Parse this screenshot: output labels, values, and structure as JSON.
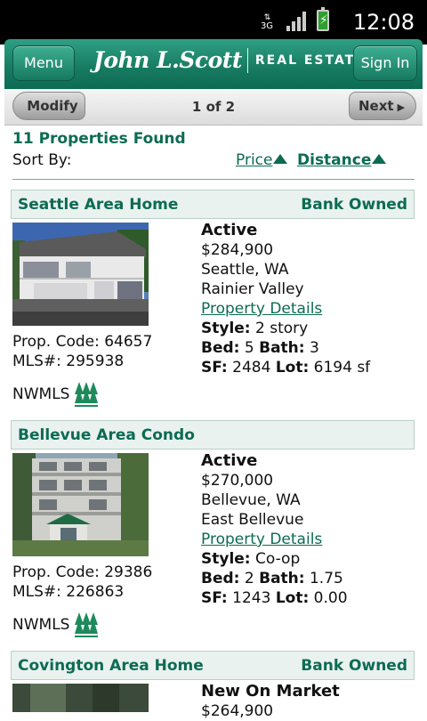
{
  "status_bar": {
    "network": "3G",
    "time": "12:08"
  },
  "header": {
    "menu_label": "Menu",
    "logo_name": "John L.Scott",
    "logo_suffix": "REAL ESTATE",
    "signin_label": "Sign In"
  },
  "pager": {
    "modify_label": "Modify",
    "page_indicator": "1 of 2",
    "next_label": "Next"
  },
  "results": {
    "found_text": "11 Properties Found",
    "sort_label": "Sort By:",
    "sort_price": "Price",
    "sort_distance": "Distance"
  },
  "listings": [
    {
      "title": "Seattle Area Home",
      "tag": "Bank Owned",
      "prop_code": "Prop. Code: 64657",
      "mls": "MLS#: 295938",
      "source": "NWMLS",
      "status": "Active",
      "price": "$284,900",
      "city": "Seattle, WA",
      "area": "Rainier Valley",
      "details_link": "Property Details",
      "style_label": "Style:",
      "style_value": "2 story",
      "bed_label": "Bed:",
      "bed_value": "5",
      "bath_label": "Bath:",
      "bath_value": "3",
      "sf_label": "SF:",
      "sf_value": "2484",
      "lot_label": "Lot:",
      "lot_value": "6194 sf"
    },
    {
      "title": "Bellevue Area Condo",
      "tag": "",
      "prop_code": "Prop. Code: 29386",
      "mls": "MLS#: 226863",
      "source": "NWMLS",
      "status": "Active",
      "price": "$270,000",
      "city": "Bellevue, WA",
      "area": "East Bellevue",
      "details_link": "Property Details",
      "style_label": "Style:",
      "style_value": "Co-op",
      "bed_label": "Bed:",
      "bed_value": "2",
      "bath_label": "Bath:",
      "bath_value": "1.75",
      "sf_label": "SF:",
      "sf_value": "1243",
      "lot_label": "Lot:",
      "lot_value": "0.00"
    },
    {
      "title": "Covington Area Home",
      "tag": "Bank Owned",
      "status": "New On Market",
      "price": "$264,900"
    }
  ],
  "icons": {
    "network_icon": "3g-data-icon",
    "signal_icon": "signal-bars-icon",
    "battery_icon": "battery-charging-icon",
    "mls_logo": "nwmls-trees-icon",
    "sort_indicator": "triangle-up-icon"
  },
  "colors": {
    "brand_green": "#0d6b53",
    "header_green": "#167a61",
    "row_bg": "#e9f2ef"
  }
}
